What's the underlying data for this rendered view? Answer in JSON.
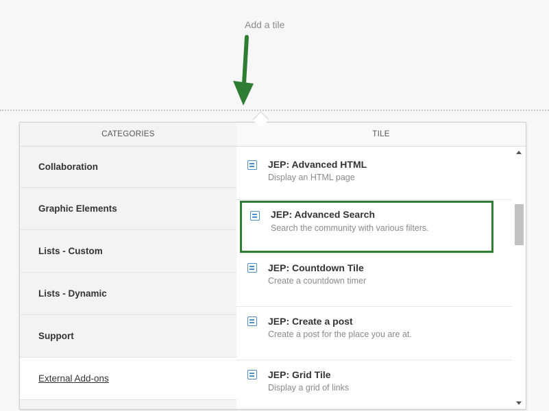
{
  "header": {
    "add_tile_label": "Add a tile"
  },
  "categories": {
    "header": "CATEGORIES",
    "items": [
      {
        "label": "Collaboration"
      },
      {
        "label": "Graphic Elements"
      },
      {
        "label": "Lists - Custom"
      },
      {
        "label": "Lists - Dynamic"
      },
      {
        "label": "Support"
      },
      {
        "label": "External Add-ons",
        "selected": true
      }
    ]
  },
  "tiles": {
    "header": "TILE",
    "items": [
      {
        "title": "JEP: Advanced HTML",
        "description": "Display an HTML page"
      },
      {
        "title": "JEP: Advanced Search",
        "description": "Search the community with various filters.",
        "highlighted": true
      },
      {
        "title": "JEP: Countdown Tile",
        "description": "Create a countdown timer"
      },
      {
        "title": "JEP: Create a post",
        "description": "Create a post for the place you are at."
      },
      {
        "title": "JEP: Grid Tile",
        "description": "Display a grid of links"
      }
    ]
  },
  "colors": {
    "highlight_border": "#2e7d32",
    "arrow": "#2e7d32",
    "tile_icon": "#4a8ed0"
  }
}
